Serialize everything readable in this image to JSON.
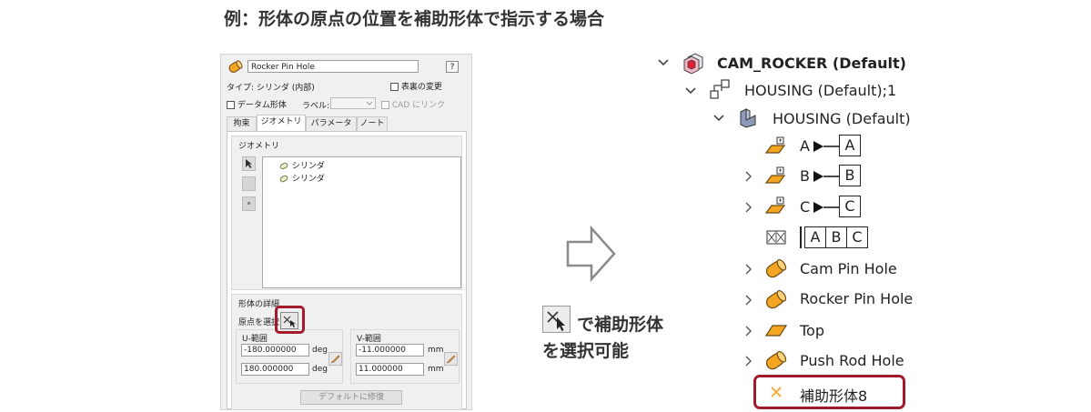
{
  "heading": "例：形体の原点の位置を補助形体で指示する場合",
  "dialog": {
    "name_value": "Rocker Pin Hole",
    "help_button": "?",
    "type_label": "タイプ: シリンダ (内部)",
    "display_change": "表裏の変更",
    "datum_feature": "データム形体",
    "label_caption": "ラベル:",
    "cad_link": "CAD にリンク",
    "tabs": [
      "拘束",
      "ジオメトリ",
      "パラメータ",
      "ノート"
    ],
    "active_tab": "ジオメトリ",
    "geometry_group": "ジオメトリ",
    "geometry_items": [
      "シリンダ",
      "シリンダ"
    ],
    "feature_detail": "形体の詳細",
    "origin_select": "原点を選択",
    "u_range": {
      "title": "U-範囲",
      "min": "-180.000000",
      "max": "180.000000",
      "unit": "deg"
    },
    "v_range": {
      "title": "V-範囲",
      "min": "-11.000000",
      "max": "11.000000",
      "unit": "mm"
    },
    "default_button": "デフォルトに修復"
  },
  "middle": {
    "line1": "で補助形体",
    "line2": "を選択可能"
  },
  "tree": {
    "root": "CAM_ROCKER (Default)",
    "sub": "HOUSING (Default);1",
    "part": "HOUSING (Default)",
    "datums": [
      {
        "prefix": "A",
        "letter": "A"
      },
      {
        "prefix": "B",
        "letter": "B"
      },
      {
        "prefix": "C",
        "letter": "C"
      }
    ],
    "fcf": [
      "A",
      "B",
      "C"
    ],
    "features": [
      "Cam Pin Hole",
      "Rocker Pin Hole",
      "Top",
      "Push Rod Hole"
    ],
    "aux": "補助形体8"
  },
  "colors": {
    "highlight": "#a31a2c",
    "feature_orange": "#f4a623",
    "feature_outline": "#6b4a12"
  }
}
